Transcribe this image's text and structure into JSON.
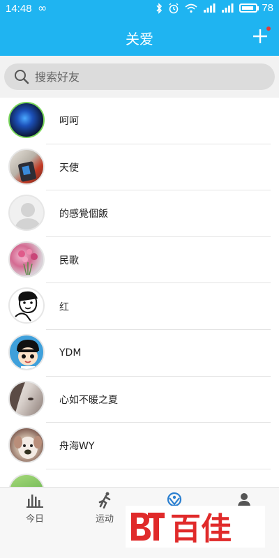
{
  "status_bar": {
    "time": "14:48",
    "battery_level": "78",
    "icons": [
      "infinity-icon",
      "bluetooth-icon",
      "alarm-icon",
      "wifi-icon",
      "signal-icon",
      "battery-icon"
    ]
  },
  "header": {
    "title": "关爱",
    "add_icon": "plus-icon",
    "accent_color": "#1fb4f1",
    "badge_color": "#e53935"
  },
  "search": {
    "placeholder": "搜索好友"
  },
  "friends": [
    {
      "name": "呵呵"
    },
    {
      "name": "天使"
    },
    {
      "name": "的感覺個飯"
    },
    {
      "name": "民歌"
    },
    {
      "name": "红"
    },
    {
      "name": "YDM"
    },
    {
      "name": "心如不暖之夏"
    },
    {
      "name": "舟海WY"
    }
  ],
  "bottom_nav": {
    "items": [
      {
        "label": "今日",
        "icon": "bar-chart-icon"
      },
      {
        "label": "运动",
        "icon": "running-icon"
      },
      {
        "label": "",
        "icon": "care-icon",
        "active": true
      },
      {
        "label": "",
        "icon": "person-icon"
      }
    ]
  },
  "watermark": {
    "text": "百佳",
    "color": "#e02a2a"
  }
}
